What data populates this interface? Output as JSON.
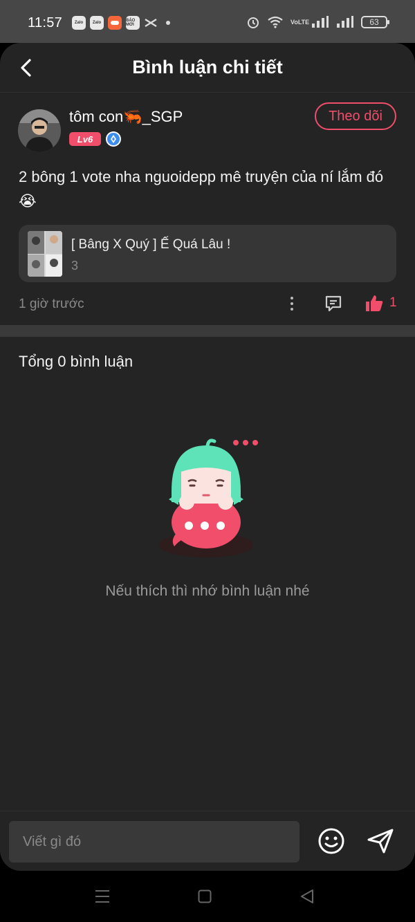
{
  "status_bar": {
    "time": "11:57",
    "notifications": [
      "Zalo",
      "Zalo",
      "game-icon",
      "BÁO MỚI",
      "capcut-icon"
    ],
    "battery": "63",
    "network": "VoLTE"
  },
  "header": {
    "title": "Bình luận chi tiết",
    "back_icon": "chevron-left-icon"
  },
  "post": {
    "author": "tôm con🦐_SGP",
    "level": "Lv6",
    "follow_label": "Theo dõi",
    "text": "2 bông 1 vote nha nguoidepp mê truyện của ní lắm đó😭",
    "story": {
      "title": "[ Bâng X Quý ] Ế Quá Lâu !",
      "count": "3"
    },
    "time": "1 giờ trước",
    "likes": "1"
  },
  "comments": {
    "total_label": "Tổng 0 bình luận",
    "empty_text": "Nếu thích thì nhớ bình luận nhé"
  },
  "input": {
    "placeholder": "Viết gì đó"
  },
  "colors": {
    "accent": "#f04e6a",
    "background": "#242424",
    "mascot_hair": "#5ee3b8"
  }
}
